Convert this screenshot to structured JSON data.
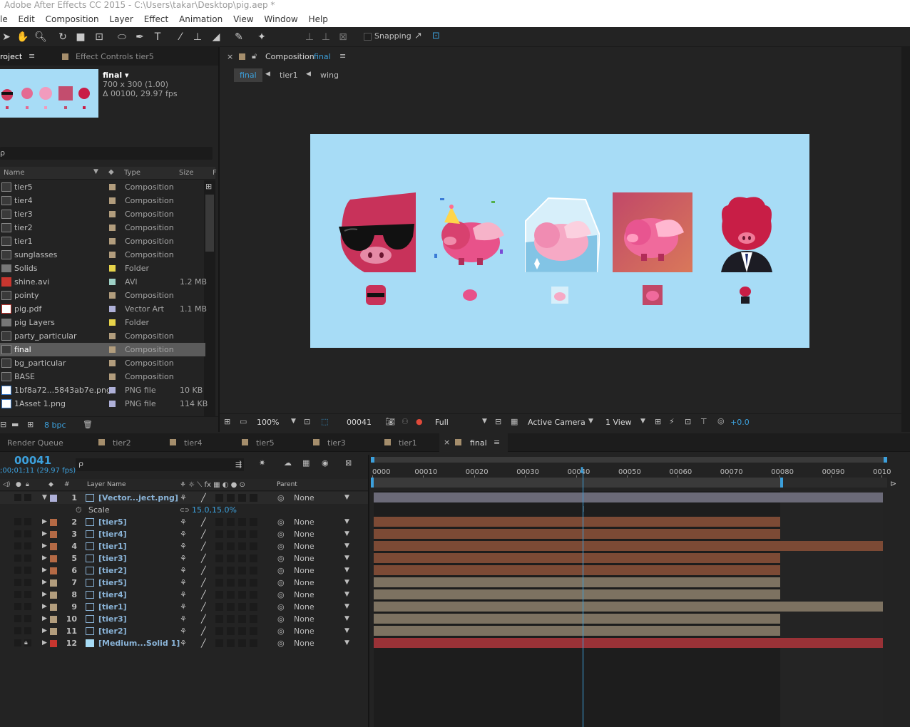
{
  "app": {
    "title": "Adobe After Effects CC 2015 - C:\\Users\\takar\\Desktop\\pig.aep *"
  },
  "menu": [
    "le",
    "Edit",
    "Composition",
    "Layer",
    "Effect",
    "Animation",
    "View",
    "Window",
    "Help"
  ],
  "toolbar": {
    "snapping_label": "Snapping"
  },
  "project_panel": {
    "tab_project": "roject",
    "tab_effect_controls": "Effect Controls tier5",
    "preview": {
      "name": "final ▾",
      "dims": "700 x 300 (1.00)",
      "duration": "Δ 00100, 29.97 fps"
    },
    "search_placeholder": "",
    "columns": {
      "name": "Name",
      "type": "Type",
      "size": "Size",
      "extra": "F"
    },
    "items": [
      {
        "name": "tier5",
        "type": "Composition",
        "size": "",
        "label": "#b29d7d",
        "kind": "comp"
      },
      {
        "name": "tier4",
        "type": "Composition",
        "size": "",
        "label": "#b29d7d",
        "kind": "comp"
      },
      {
        "name": "tier3",
        "type": "Composition",
        "size": "",
        "label": "#b29d7d",
        "kind": "comp"
      },
      {
        "name": "tier2",
        "type": "Composition",
        "size": "",
        "label": "#b29d7d",
        "kind": "comp"
      },
      {
        "name": "tier1",
        "type": "Composition",
        "size": "",
        "label": "#b29d7d",
        "kind": "comp"
      },
      {
        "name": "sunglasses",
        "type": "Composition",
        "size": "",
        "label": "#b29d7d",
        "kind": "comp"
      },
      {
        "name": "Solids",
        "type": "Folder",
        "size": "",
        "label": "#e6d34a",
        "kind": "folder"
      },
      {
        "name": "shine.avi",
        "type": "AVI",
        "size": "1.2 MB",
        "label": "#9ed1c6",
        "kind": "avi"
      },
      {
        "name": "pointy",
        "type": "Composition",
        "size": "",
        "label": "#b29d7d",
        "kind": "comp"
      },
      {
        "name": "pig.pdf",
        "type": "Vector Art",
        "size": "1.1 MB",
        "label": "#aeb0d8",
        "kind": "pdf"
      },
      {
        "name": "pig Layers",
        "type": "Folder",
        "size": "",
        "label": "#e6d34a",
        "kind": "folder"
      },
      {
        "name": "party_particular",
        "type": "Composition",
        "size": "",
        "label": "#b29d7d",
        "kind": "comp"
      },
      {
        "name": "final",
        "type": "Composition",
        "size": "",
        "label": "#b29d7d",
        "kind": "comp",
        "selected": true
      },
      {
        "name": "bg_particular",
        "type": "Composition",
        "size": "",
        "label": "#b29d7d",
        "kind": "comp"
      },
      {
        "name": "BASE",
        "type": "Composition",
        "size": "",
        "label": "#b29d7d",
        "kind": "comp"
      },
      {
        "name": "1bf8a72...5843ab7e.png",
        "type": "PNG file",
        "size": "10 KB",
        "label": "#aeb0d8",
        "kind": "png"
      },
      {
        "name": "1Asset 1.png",
        "type": "PNG file",
        "size": "114 KB",
        "label": "#aeb0d8",
        "kind": "png"
      }
    ],
    "bpc": "8 bpc"
  },
  "comp_panel": {
    "tab_prefix": "Composition",
    "tab_name": "final",
    "breadcrumbs": [
      "final",
      "tier1",
      "wing"
    ],
    "bg_color": "#a7dcf6",
    "footer": {
      "zoom": "100%",
      "timecode": "00041",
      "resolution": "Full",
      "camera": "Active Camera",
      "views": "1 View",
      "exposure": "+0.0"
    }
  },
  "timeline": {
    "tabs": [
      "Render Queue",
      "tier2",
      "tier4",
      "tier5",
      "tier3",
      "tier1",
      "final"
    ],
    "timecode": "00041",
    "timecode_sub": ";00;01;11 (29.97 fps)",
    "ruler_labels": [
      "0000",
      "00010",
      "00020",
      "00030",
      "00040",
      "00050",
      "00060",
      "00070",
      "00080",
      "00090",
      "0010"
    ],
    "headers": {
      "hash": "#",
      "layer_name": "Layer Name",
      "parent": "Parent"
    },
    "scale_label": "Scale",
    "scale_value": "15.0,15.0%",
    "layers": [
      {
        "num": "1",
        "name": "[Vector...ject.png]",
        "label": "#aeb0d8",
        "parent": "None",
        "bar": "#6b6a78",
        "end": "full",
        "expanded": true
      },
      {
        "num": "2",
        "name": "[tier5]",
        "label": "#b56a45",
        "parent": "None",
        "bar": "#7c4a35",
        "end": "80"
      },
      {
        "num": "3",
        "name": "[tier4]",
        "label": "#b56a45",
        "parent": "None",
        "bar": "#7c4a35",
        "end": "80"
      },
      {
        "num": "4",
        "name": "[tier1]",
        "label": "#b56a45",
        "parent": "None",
        "bar": "#7c4a35",
        "end": "full"
      },
      {
        "num": "5",
        "name": "[tier3]",
        "label": "#b56a45",
        "parent": "None",
        "bar": "#7c4a35",
        "end": "80"
      },
      {
        "num": "6",
        "name": "[tier2]",
        "label": "#b56a45",
        "parent": "None",
        "bar": "#7c4a35",
        "end": "80"
      },
      {
        "num": "7",
        "name": "[tier5]",
        "label": "#b29d7d",
        "parent": "None",
        "bar": "#7d7261",
        "end": "80"
      },
      {
        "num": "8",
        "name": "[tier4]",
        "label": "#b29d7d",
        "parent": "None",
        "bar": "#7d7261",
        "end": "80"
      },
      {
        "num": "9",
        "name": "[tier1]",
        "label": "#b29d7d",
        "parent": "None",
        "bar": "#7d7261",
        "end": "full"
      },
      {
        "num": "10",
        "name": "[tier3]",
        "label": "#b29d7d",
        "parent": "None",
        "bar": "#7d7261",
        "end": "80"
      },
      {
        "num": "11",
        "name": "[tier2]",
        "label": "#b29d7d",
        "parent": "None",
        "bar": "#7d7261",
        "end": "80"
      },
      {
        "num": "12",
        "name": "[Medium...Solid 1]",
        "label": "#c8362f",
        "parent": "None",
        "bar": "#9a3237",
        "end": "full",
        "locked": true,
        "solid": true
      }
    ]
  }
}
